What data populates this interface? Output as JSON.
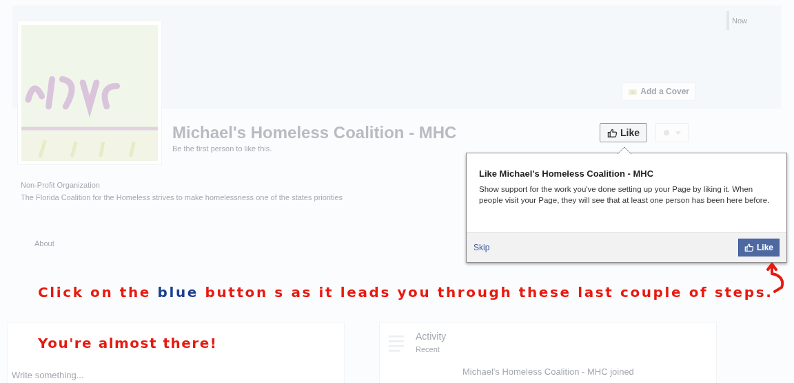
{
  "cover": {
    "tab": "Now",
    "add_cover_button": "Add a Cover"
  },
  "page": {
    "title": "Michael's Homeless Coalition - MHC",
    "likes_line": "Be the first person to like this.",
    "category": "Non-Profit Organization",
    "description": "The Florida Coalition for the Homeless strives to make homelessness one of the states priorities",
    "like_button": "Like",
    "about_tab": "About"
  },
  "popup": {
    "title": "Like Michael's Homeless Coalition - MHC",
    "body": "Show support for the work you've done setting up your Page by liking it. When people visit your Page, they will see that at least one person has been here before.",
    "skip": "Skip",
    "like_button": "Like"
  },
  "annotation": {
    "before": "Click on the",
    "highlight": "blue",
    "after": "button s as it leads you through these last couple of steps.",
    "second_line": "You're almost there!"
  },
  "composer": {
    "placeholder": "Write something..."
  },
  "activity": {
    "title": "Activity",
    "subtitle": "Recent",
    "entry": "Michael's Homeless Coalition - MHC joined"
  }
}
